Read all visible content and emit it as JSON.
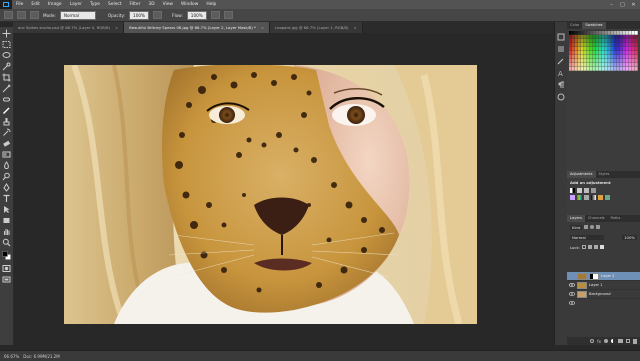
{
  "menu": {
    "items": [
      "File",
      "Edit",
      "Image",
      "Layer",
      "Type",
      "Select",
      "Filter",
      "3D",
      "View",
      "Window",
      "Help"
    ]
  },
  "options": {
    "mode_label": "Mode:",
    "mode_value": "Normal",
    "opacity_label": "Opacity:",
    "opacity_value": "100%",
    "flow_label": "Flow:",
    "flow_value": "100%"
  },
  "tabs": [
    {
      "label": "ace Spikes studio.psd @ 66.7% (Layer 0, RGB/8)",
      "close": "×"
    },
    {
      "label": "Beautiful Britney Spears 08.jpg @ 66.7% (Layer 2, Layer Mask/8) *",
      "close": "×",
      "active": true
    },
    {
      "label": "Leopard.jpg @ 66.7% (Layer 1, RGB/8)",
      "close": "×"
    }
  ],
  "panels": {
    "swatches_tabs": [
      "Color",
      "Swatches"
    ],
    "adjustments_tabs": [
      "Adjustments",
      "Styles"
    ],
    "adjustments_hint": "Add an adjustment",
    "layers_tabs": [
      "Layers",
      "Channels",
      "Paths"
    ],
    "layers_kind": "Kind",
    "layers_blend": "Normal",
    "layers_opacity": "100%",
    "lock_label": "Lock:",
    "layers": [
      {
        "name": "Layer 2",
        "selected": true,
        "thumb": "#a57a35",
        "mask": true
      },
      {
        "name": "Layer 1",
        "selected": false,
        "thumb": "#b88d3e"
      },
      {
        "name": "Background",
        "selected": false,
        "thumb": "#c9a067"
      }
    ]
  },
  "status": {
    "zoom": "66.67%",
    "doc": "Doc: 6.99M/21.2M"
  },
  "colors": {
    "accent": "#31a8ff",
    "selected_layer": "#6e8fb6",
    "canvas_bg": "#282828"
  }
}
